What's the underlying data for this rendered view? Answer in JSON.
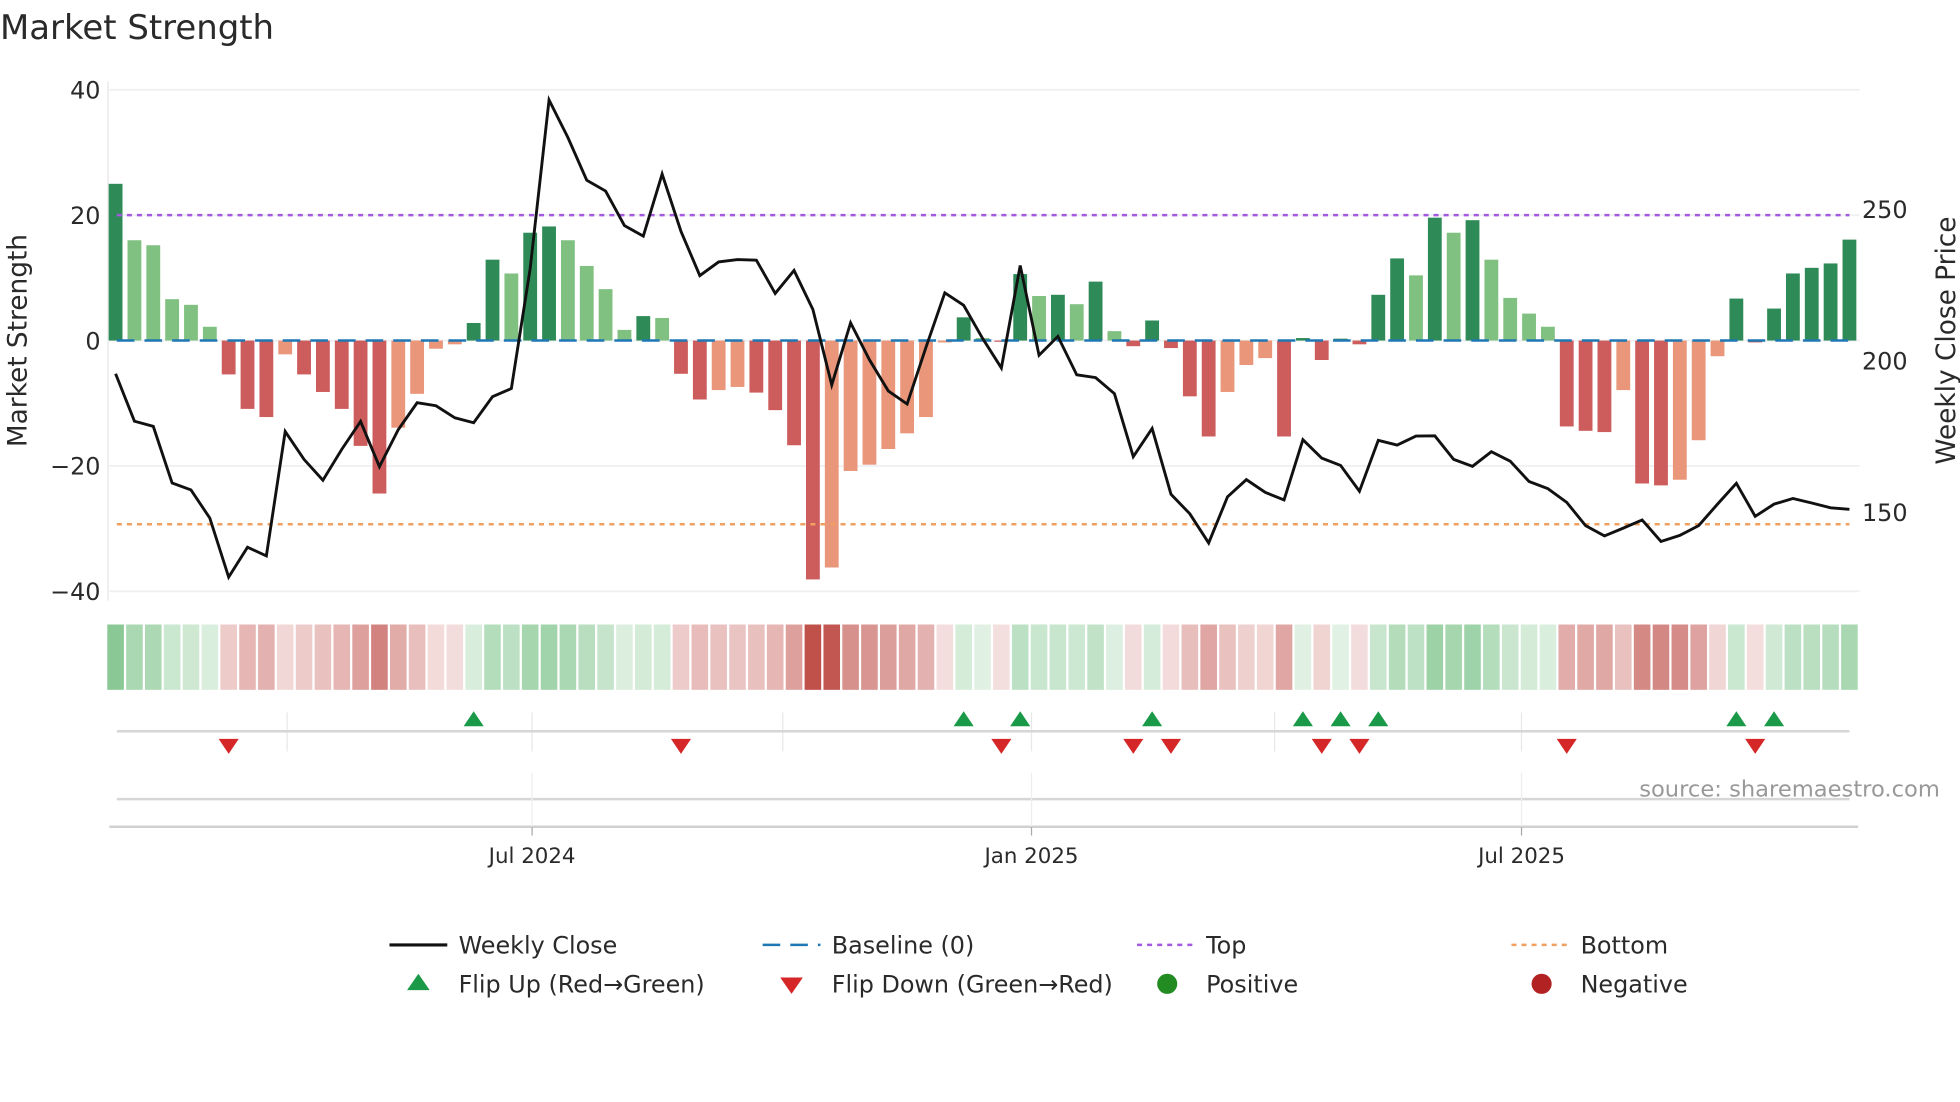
{
  "chart_data": {
    "type": "bar",
    "title": "Market Strength",
    "ylabel": "Market Strength",
    "y2label": "Weekly Close Price",
    "ylim": [
      -41.5,
      41.5
    ],
    "y2lim": [
      123.5,
      289.5
    ],
    "yticks": [
      40,
      20,
      0,
      -20,
      -40
    ],
    "yticks_labels": [
      "40",
      "20",
      "0",
      "−20",
      "−40"
    ],
    "y2ticks": [
      250,
      200,
      150
    ],
    "y2ticks_labels": [
      "250",
      "200",
      "150"
    ],
    "x_unit": "week index",
    "xticks": [
      {
        "pos": 22.1,
        "label": "Jul 2024"
      },
      {
        "pos": 48.6,
        "label": "Jan 2025"
      },
      {
        "pos": 74.6,
        "label": "Jul 2025"
      }
    ],
    "quarter_gridlines": [
      9.1,
      22.1,
      35.4,
      48.6,
      61.5,
      74.6
    ],
    "grid": true,
    "top_level": 20,
    "bottom_level": -29.3,
    "baseline": 0,
    "strength": [
      25.0,
      16.0,
      15.2,
      6.6,
      5.7,
      2.2,
      -5.4,
      -10.9,
      -12.2,
      -2.2,
      -5.4,
      -8.2,
      -10.9,
      -16.8,
      -24.4,
      -13.9,
      -8.5,
      -1.3,
      -0.6,
      2.8,
      12.9,
      10.7,
      17.2,
      18.2,
      16.0,
      11.9,
      8.2,
      1.7,
      3.9,
      3.6,
      -5.3,
      -9.4,
      -7.9,
      -7.4,
      -8.3,
      -11.1,
      -16.7,
      -38.1,
      -36.2,
      -20.8,
      -19.8,
      -17.3,
      -14.8,
      -12.2,
      -0.3,
      3.7,
      0.4,
      -0.2,
      10.6,
      7.1,
      7.3,
      5.8,
      9.4,
      1.5,
      -0.9,
      3.2,
      -1.2,
      -8.9,
      -15.3,
      -8.2,
      -3.9,
      -2.8,
      -15.3,
      0.4,
      -3.1,
      0.3,
      -0.6,
      7.3,
      13.1,
      10.4,
      19.6,
      17.2,
      19.2,
      12.9,
      6.8,
      4.3,
      2.2,
      -13.7,
      -14.4,
      -14.6,
      -7.9,
      -22.8,
      -23.1,
      -22.2,
      -15.9,
      -2.5,
      6.7,
      -0.3,
      5.1,
      10.7,
      11.6,
      12.3,
      16.1
    ],
    "weekly_close": [
      195.7,
      180.0,
      178.3,
      159.6,
      157.3,
      148.0,
      128.5,
      138.4,
      135.5,
      176.6,
      167.4,
      160.5,
      170.7,
      179.9,
      165.0,
      177.2,
      186.1,
      185.1,
      181.1,
      179.5,
      188.1,
      190.8,
      230.5,
      286.1,
      273.7,
      259.6,
      256.0,
      244.6,
      241.1,
      261.6,
      242.7,
      228.1,
      232.6,
      233.4,
      233.2,
      222.2,
      229.8,
      216.9,
      192.0,
      212.5,
      200.3,
      190.0,
      185.7,
      204.4,
      222.4,
      218.3,
      207.4,
      197.6,
      231.4,
      201.8,
      208.0,
      195.3,
      194.4,
      189.1,
      168.3,
      177.6,
      155.9,
      149.4,
      139.8,
      155.0,
      160.7,
      156.5,
      154.0,
      173.9,
      167.8,
      165.4,
      156.9,
      173.7,
      172.1,
      175.1,
      175.2,
      167.4,
      165.1,
      169.9,
      166.8,
      160.1,
      157.7,
      153.2,
      145.5,
      142.1,
      144.7,
      147.4,
      140.3,
      142.3,
      145.5,
      152.6,
      159.5,
      148.6,
      152.6,
      154.5,
      153.0,
      151.4,
      150.9
    ],
    "flip_up": [
      19,
      45,
      48,
      55,
      63,
      65,
      67,
      86,
      88
    ],
    "flip_down": [
      6,
      30,
      47,
      54,
      56,
      64,
      66,
      77,
      87
    ],
    "colors": {
      "pos_rising": "#2e8b57",
      "pos_falling": "#80c080",
      "neg_falling": "#cd5c5c",
      "neg_rising": "#e9967a",
      "line": "#111111",
      "baseline": "#1f77b4",
      "top": "#a259e0",
      "bottom": "#f0a060",
      "flip_up": "#1a9a48",
      "flip_down": "#d62728",
      "positive": "#228b22",
      "negative": "#b22222",
      "heat_pos": "#5cb46c",
      "heat_neg": "#c0504a"
    },
    "legend_placement": "bottom",
    "legend": [
      {
        "key": "weekly_close",
        "label": "Weekly Close"
      },
      {
        "key": "baseline",
        "label": "Baseline (0)"
      },
      {
        "key": "top",
        "label": "Top"
      },
      {
        "key": "bottom",
        "label": "Bottom"
      },
      {
        "key": "flip_up",
        "label": "Flip Up (Red→Green)"
      },
      {
        "key": "flip_down",
        "label": "Flip Down (Green→Red)"
      },
      {
        "key": "positive",
        "label": "Positive"
      },
      {
        "key": "negative",
        "label": "Negative"
      }
    ],
    "source": "source: sharemaestro.com"
  }
}
